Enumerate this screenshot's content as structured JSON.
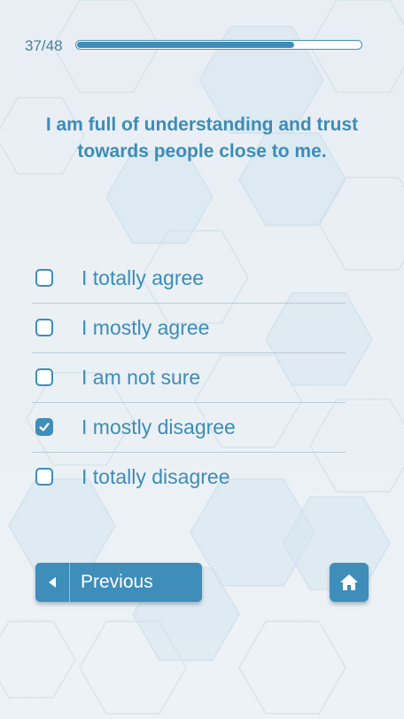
{
  "progress": {
    "label": "37/48",
    "current": 37,
    "total": 48
  },
  "question": {
    "text": "I am full of understanding and trust towards people close to me."
  },
  "options": [
    {
      "label": "I totally agree",
      "checked": false
    },
    {
      "label": "I mostly agree",
      "checked": false
    },
    {
      "label": "I am not sure",
      "checked": false
    },
    {
      "label": "I mostly disagree",
      "checked": true
    },
    {
      "label": "I totally disagree",
      "checked": false
    }
  ],
  "nav": {
    "previous_label": "Previous",
    "previous_icon": "caret-left-icon",
    "home_icon": "home-icon"
  },
  "colors": {
    "accent": "#3f8db9",
    "text": "#3d8cb8",
    "background": "#e9eff4"
  }
}
